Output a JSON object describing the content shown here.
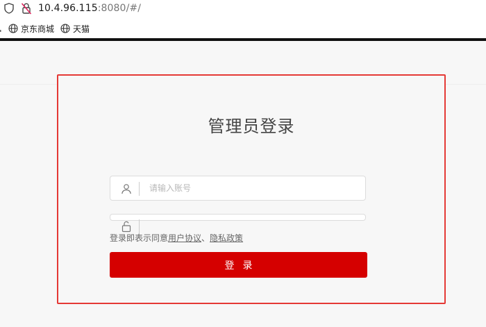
{
  "browser": {
    "url_host": "10.4.96.115",
    "url_rest": ":8080/#/",
    "bookmarks": [
      {
        "label": "京东商城"
      },
      {
        "label": "天猫"
      }
    ]
  },
  "login": {
    "title": "管理员登录",
    "username_placeholder": "请输入账号",
    "agreement_prefix": "登录即表示同意",
    "user_agreement": "用户协议",
    "separator": "、",
    "privacy_policy": "隐私政策",
    "submit_label": "登录"
  },
  "colors": {
    "accent": "#d50000",
    "highlight_border": "#e53935"
  }
}
